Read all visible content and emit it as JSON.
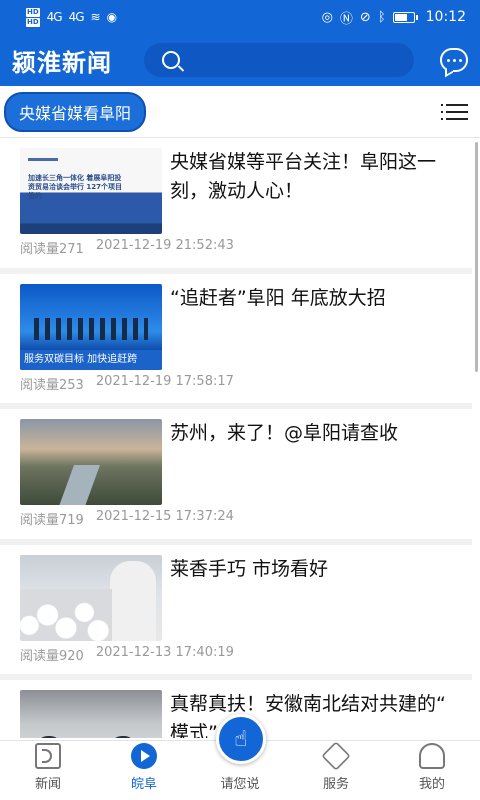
{
  "status_bar": {
    "network_1": "HD",
    "network_2": "HD",
    "signal_1": "4G",
    "signal_2": "4G",
    "time": "10:12"
  },
  "app": {
    "title": "颍淮新闻",
    "search_placeholder": ""
  },
  "channel": {
    "label": "央媒省媒看阜阳"
  },
  "news": [
    {
      "title": "央媒省媒等平台关注！阜阳这一刻，激动人心！",
      "reads": "阅读量271",
      "time": "2021-12-19  21:52:43",
      "thumb_text": "加速长三角一体化 着展阜阳投资贸易洽谈会举行 127个项目签约"
    },
    {
      "title": "“追赶者”阜阳  年底放大招",
      "reads": "阅读量253",
      "time": "2021-12-19  17:58:17",
      "thumb_text": "服务双碳目标    加快追赶跨"
    },
    {
      "title": "苏州，来了！@阜阳请查收",
      "reads": "阅读量719",
      "time": "2021-12-15  17:37:24",
      "thumb_text": ""
    },
    {
      "title": "莱香手巧  市场看好",
      "reads": "阅读量920",
      "time": "2021-12-13  17:40:19",
      "thumb_text": ""
    },
    {
      "title": "真帮真扶！安徽南北结对共建的“     模式”！",
      "reads": "",
      "time": "",
      "thumb_text": ""
    }
  ],
  "nav": [
    {
      "label": "新闻",
      "icon": "news-icon"
    },
    {
      "label": "皖阜",
      "icon": "play-icon"
    },
    {
      "label": "请您说",
      "icon": "hand-tap-icon"
    },
    {
      "label": "服务",
      "icon": "service-icon"
    },
    {
      "label": "我的",
      "icon": "user-icon"
    }
  ],
  "colors": {
    "brand": "#1366d6",
    "meta_text": "#999999"
  }
}
